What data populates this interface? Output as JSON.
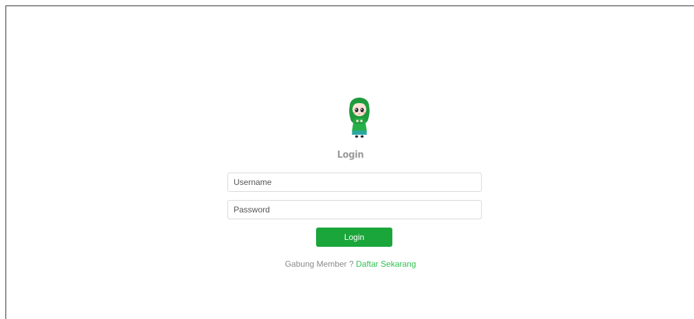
{
  "login": {
    "mascot": "hijab-girl-mascot-illustration",
    "title": "Login",
    "username_placeholder": "Username",
    "password_placeholder": "Password",
    "button_label": "Login",
    "footer_text": "Gabung Member ?",
    "signup_link": "Daftar Sekarang"
  },
  "colors": {
    "accent_green": "#1aa63a",
    "link_green": "#2ec04f",
    "title_gray": "#9a9a9a",
    "text_gray": "#8a8a8a"
  }
}
